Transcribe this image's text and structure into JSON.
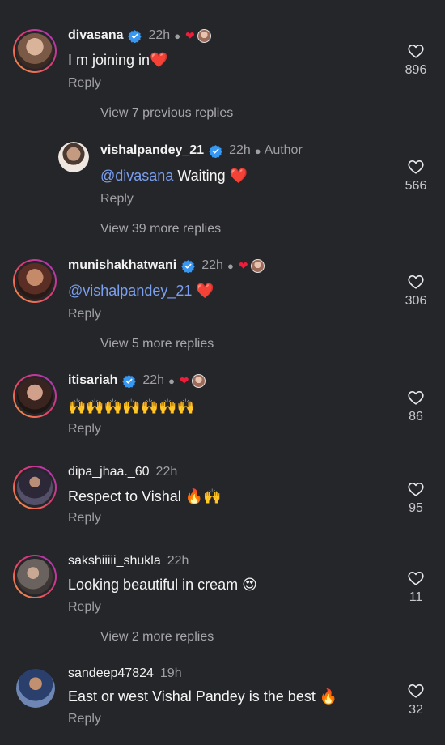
{
  "comments": [
    {
      "username": "divasana",
      "verified": true,
      "time": "22h",
      "creator_liked": true,
      "text": "I m joining in",
      "text_emoji": "❤️",
      "reply_label": "Reply",
      "likes": "896",
      "avatar_colors": [
        "#8b6a4e",
        "#d7b49a"
      ]
    },
    {
      "username": "vishalpandey_21",
      "verified": true,
      "time": "22h",
      "author_label": "Author",
      "mention": "@divasana",
      "text": "Waiting",
      "text_emoji": "❤️",
      "reply_label": "Reply",
      "likes": "566",
      "avatar_colors": [
        "#c7b3a3",
        "#efe4da"
      ]
    },
    {
      "username": "munishakhatwani",
      "verified": true,
      "time": "22h",
      "creator_liked": true,
      "mention": "@vishalpandey_21",
      "text_emoji": "❤️",
      "reply_label": "Reply",
      "likes": "306",
      "avatar_colors": [
        "#5a3a2e",
        "#b07a5e"
      ]
    },
    {
      "username": "itisariah",
      "verified": true,
      "time": "22h",
      "creator_liked": true,
      "text": "🙌🙌🙌🙌🙌🙌🙌",
      "reply_label": "Reply",
      "likes": "86",
      "avatar_colors": [
        "#3a2a26",
        "#c08e78"
      ]
    },
    {
      "username": "dipa_jhaa._60",
      "verified": false,
      "time": "22h",
      "text": "Respect to Vishal",
      "text_emoji": "🔥🙌",
      "reply_label": "Reply",
      "likes": "95",
      "avatar_colors": [
        "#2f2d3a",
        "#6a5e76"
      ]
    },
    {
      "username": "sakshiiiii_shukla",
      "verified": false,
      "time": "22h",
      "text": "Looking beautiful in cream",
      "text_emoji": "😍",
      "reply_label": "Reply",
      "likes": "11",
      "avatar_colors": [
        "#5c5552",
        "#a59a94"
      ]
    },
    {
      "username": "sandeep47824",
      "verified": false,
      "time": "19h",
      "text": "East or west Vishal Pandey is the best",
      "text_emoji": "🔥",
      "reply_label": "Reply",
      "likes": "32",
      "avatar_colors": [
        "#2a3f6b",
        "#8aa0c4"
      ]
    }
  ],
  "view_more": {
    "v1": "View 7 previous replies",
    "v2": "View 39 more replies",
    "v3": "View 5 more replies",
    "v4": "View 2 more replies"
  },
  "colors": {
    "background": "#25262a",
    "verified": "#3897f0",
    "heart_red": "#ee1d3a",
    "mention": "#7a9ff0"
  }
}
